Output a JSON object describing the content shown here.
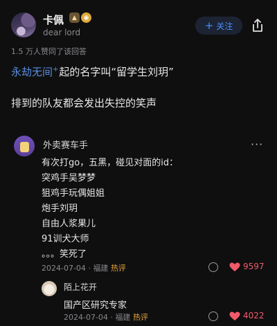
{
  "author": {
    "name": "卡佩",
    "bio": "dear lord",
    "badge_level": "▲",
    "badge_vip": "◉",
    "follow_label": "关注",
    "follow_plus": "+"
  },
  "agree_text": "1.5 万人赞同了该回答",
  "answer": {
    "line1_link": "永劫无间",
    "line1_plus": "+",
    "line1_rest": "起的名字叫“留学生刘玥”",
    "line2": "排到的队友都会发出失控的笑声"
  },
  "comment": {
    "user": "外卖赛车手",
    "more": "···",
    "lines": [
      "有次打go，五黑，碰见对面的id：",
      "突鸡手吴梦梦",
      "狙鸡手玩偶姐姐",
      "炮手刘玥",
      "自由人浆果儿",
      "91训犬大师",
      "。。。笑死了"
    ],
    "date": "2024-07-04",
    "location": "福建",
    "hot": "热评",
    "likes": "9597",
    "reply": {
      "user": "陌上花开",
      "text": "国产区研究专家",
      "date": "2024-07-04",
      "location": "福建",
      "hot": "热评",
      "likes": "4022"
    }
  },
  "colors": {
    "accent": "#4c8dff",
    "link": "#5a8fe0",
    "like": "#f05a6a",
    "hot": "#e4a33a"
  },
  "icons": [
    "share-icon",
    "more-icon",
    "reply-icon",
    "heart-icon"
  ]
}
